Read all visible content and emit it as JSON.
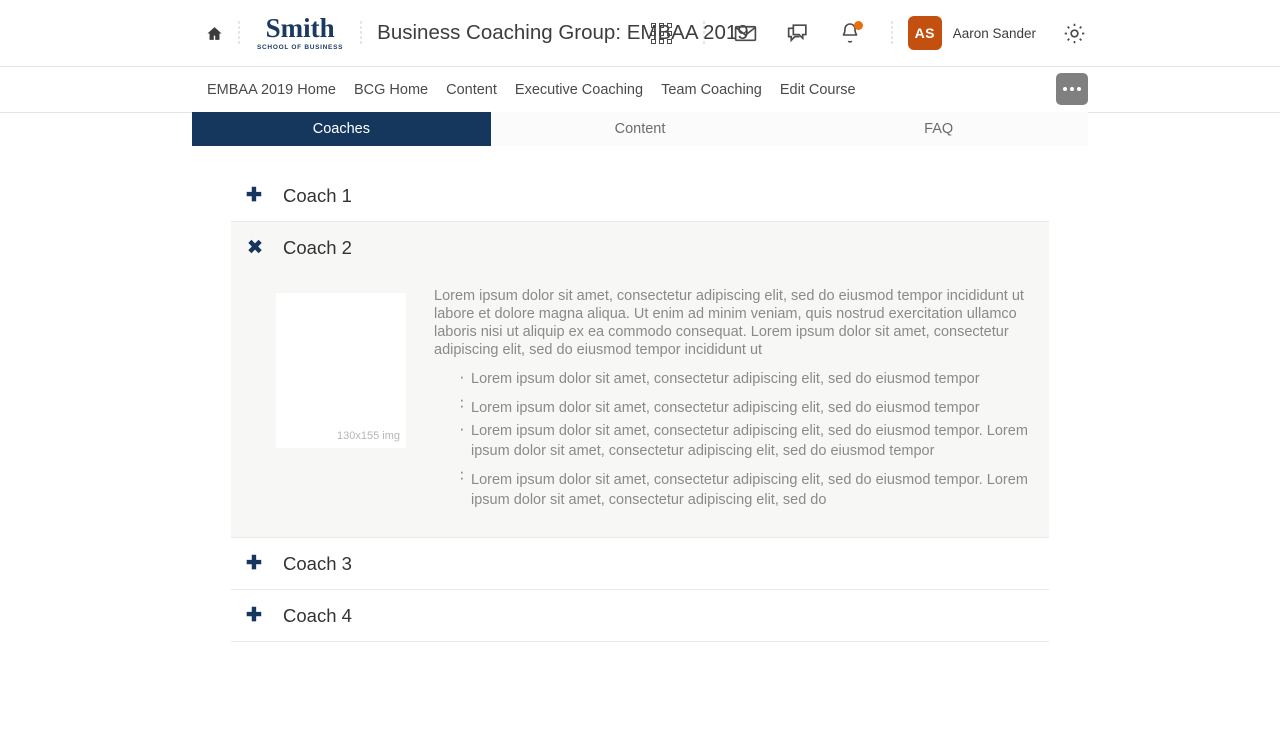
{
  "header": {
    "home_icon": "home-icon",
    "logo": {
      "word": "Smith",
      "sub": "SCHOOL OF BUSINESS"
    },
    "course_title": "Business Coaching Group: EMBAA 2019",
    "icons": [
      "apps-grid-icon",
      "mail-icon",
      "chat-icon",
      "bell-icon",
      "gear-icon"
    ],
    "user": {
      "initials": "AS",
      "name": "Aaron Sander",
      "avatar_color": "#c4500f"
    },
    "notification_color": "#e8700c"
  },
  "course_nav": {
    "items": [
      {
        "label": "EMBAA 2019 Home"
      },
      {
        "label": "BCG Home"
      },
      {
        "label": "Content"
      },
      {
        "label": "Executive Coaching"
      },
      {
        "label": "Team Coaching"
      },
      {
        "label": "Edit Course"
      }
    ],
    "more_button": "..."
  },
  "tabs": {
    "active_color": "#16375d",
    "items": [
      {
        "label": "Coaches",
        "active": true
      },
      {
        "label": "Content",
        "active": false
      },
      {
        "label": "FAQ",
        "active": false
      }
    ]
  },
  "accordion": {
    "items": [
      {
        "title": "Coach 1",
        "open": false,
        "toggle": "plus-icon"
      },
      {
        "title": "Coach 2",
        "open": true,
        "toggle": "close-icon"
      },
      {
        "title": "Coach 3",
        "open": false,
        "toggle": "plus-icon"
      },
      {
        "title": "Coach 4",
        "open": false,
        "toggle": "plus-icon"
      }
    ],
    "open_panel": {
      "image_label": "130x155 img",
      "paragraph": "Lorem ipsum dolor sit amet, consectetur adipiscing elit, sed do eiusmod tempor incididunt ut labore et dolore magna aliqua. Ut enim ad minim veniam, quis nostrud exercitation ullamco laboris nisi ut aliquip ex ea commodo consequat. Lorem ipsum dolor sit amet, consectetur adipiscing elit, sed do eiusmod tempor incididunt ut",
      "bullets": [
        "Lorem ipsum dolor sit amet, consectetur adipiscing elit, sed do eiusmod tempor",
        "",
        "Lorem ipsum dolor sit amet, consectetur adipiscing elit, sed do eiusmod tempor",
        "Lorem ipsum dolor sit amet, consectetur adipiscing elit, sed do eiusmod tempor. Lorem ipsum dolor sit amet, consectetur adipiscing elit, sed do eiusmod tempor",
        "",
        "Lorem ipsum dolor sit amet, consectetur adipiscing elit, sed do eiusmod tempor. Lorem ipsum dolor sit amet, consectetur adipiscing elit, sed do"
      ]
    }
  }
}
